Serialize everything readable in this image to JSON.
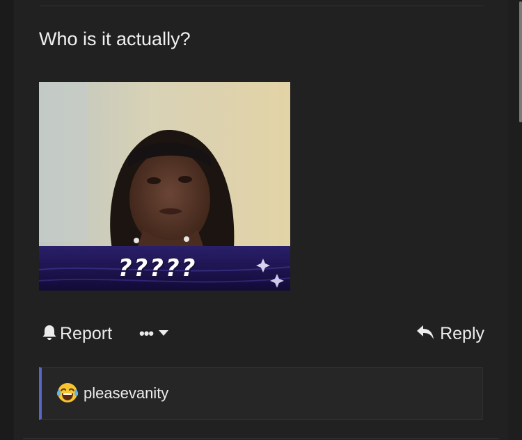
{
  "post": {
    "text": "Who is it actually?",
    "image_caption": "?????"
  },
  "actions": {
    "report_label": "Report",
    "more_label": "•••",
    "reply_label": "Reply"
  },
  "reaction": {
    "emoji": "face-with-tears-of-joy",
    "username": "pleasevanity"
  },
  "colors": {
    "background": "#1c1c1c",
    "panel": "#212121",
    "accent": "#5865c7"
  }
}
